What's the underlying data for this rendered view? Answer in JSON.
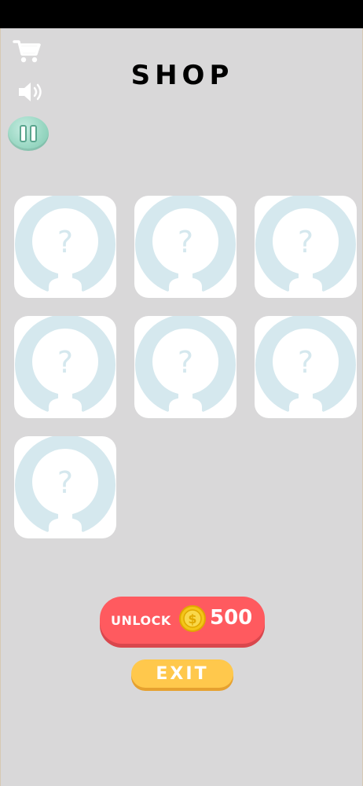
{
  "header": {
    "title": "SHOP"
  },
  "controls": {
    "cart_icon": "cart-icon",
    "sound_icon": "speaker-icon",
    "pause_icon": "pause-icon"
  },
  "shop": {
    "items": [
      {
        "state": "locked",
        "mark": "?"
      },
      {
        "state": "locked",
        "mark": "?"
      },
      {
        "state": "locked",
        "mark": "?"
      },
      {
        "state": "locked",
        "mark": "?"
      },
      {
        "state": "locked",
        "mark": "?"
      },
      {
        "state": "locked",
        "mark": "?"
      },
      {
        "state": "locked",
        "mark": "?"
      }
    ]
  },
  "actions": {
    "unlock_label": "UNLOCK",
    "unlock_price": "500",
    "coin_icon": "coin-icon",
    "exit_label": "EXIT"
  },
  "colors": {
    "background": "#d9d8d9",
    "card": "#ffffff",
    "silhouette": "#d5e8ee",
    "unlock_button": "#ff5a5f",
    "exit_button": "#ffc84c",
    "coin": "#f4c518"
  }
}
